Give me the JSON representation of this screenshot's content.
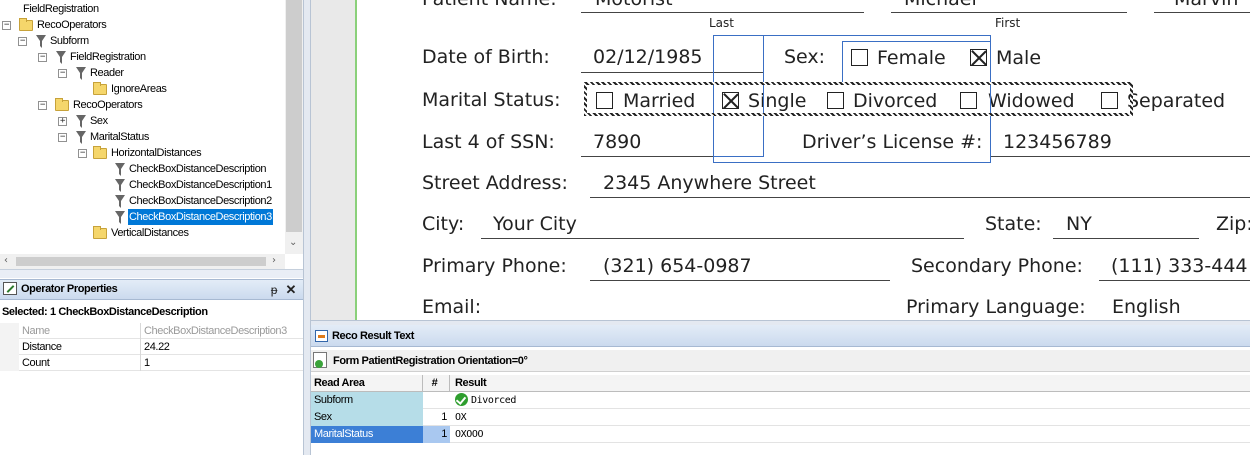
{
  "tree": {
    "nodes": [
      {
        "label": "FieldRegistration",
        "icon": "funnel-icon"
      },
      {
        "label": "RecoOperators",
        "icon": "folder-icon"
      },
      {
        "label": "Subform",
        "icon": "funnel-icon"
      },
      {
        "label": "FieldRegistration",
        "icon": "funnel-icon"
      },
      {
        "label": "Reader",
        "icon": "funnel-icon"
      },
      {
        "label": "IgnoreAreas",
        "icon": "folder-icon"
      },
      {
        "label": "RecoOperators",
        "icon": "folder-icon"
      },
      {
        "label": "Sex",
        "icon": "funnel-icon"
      },
      {
        "label": "MaritalStatus",
        "icon": "funnel-icon"
      },
      {
        "label": "HorizontalDistances",
        "icon": "folder-icon"
      },
      {
        "label": "CheckBoxDistanceDescription",
        "icon": "funnel-icon"
      },
      {
        "label": "CheckBoxDistanceDescription1",
        "icon": "funnel-icon"
      },
      {
        "label": "CheckBoxDistanceDescription2",
        "icon": "funnel-icon"
      },
      {
        "label": "CheckBoxDistanceDescription3",
        "icon": "funnel-icon",
        "selected": true
      },
      {
        "label": "VerticalDistances",
        "icon": "folder-icon"
      }
    ]
  },
  "properties": {
    "title": "Operator Properties",
    "pin_glyph": "ᵽ",
    "close_glyph": "✕",
    "selected_label": "Selected:  1 CheckBoxDistanceDescription",
    "rows": [
      {
        "name": "Name",
        "value": "CheckBoxDistanceDescription3",
        "readonly": true
      },
      {
        "name": "Distance",
        "value": "24.22"
      },
      {
        "name": "Count",
        "value": "1"
      }
    ]
  },
  "document": {
    "patient_name_label": "Patient Name:",
    "last_value": "Motorist",
    "first_value": "Michael",
    "middle_value": "Marvin",
    "last_caption": "Last",
    "first_caption": "First",
    "dob_label": "Date of Birth:",
    "dob_value": "02/12/1985",
    "sex_label": "Sex:",
    "sex_options": [
      {
        "label": "Female",
        "checked": false
      },
      {
        "label": "Male",
        "checked": true
      }
    ],
    "marital_label": "Marital Status:",
    "marital_options": [
      {
        "label": "Married",
        "checked": false
      },
      {
        "label": "Single",
        "checked": true
      },
      {
        "label": "Divorced",
        "checked": false
      },
      {
        "label": "Widowed",
        "checked": false
      },
      {
        "label": "Separated",
        "checked": false
      }
    ],
    "ssn_label": "Last 4 of SSN:",
    "ssn_value": "7890",
    "license_label": "Driver’s License #:",
    "license_value": "123456789",
    "street_label": "Street Address:",
    "street_value": "2345 Anywhere Street",
    "city_label": "City:",
    "city_value": "Your City",
    "state_label": "State:",
    "state_value": "NY",
    "zip_label": "Zip:",
    "primary_phone_label": "Primary Phone:",
    "primary_phone_value": "(321) 654-0987",
    "secondary_phone_label": "Secondary Phone:",
    "secondary_phone_value": "(111) 333-444",
    "email_label": "Email:",
    "language_label": "Primary Language:",
    "language_value": "English"
  },
  "reco": {
    "title": "Reco Result Text",
    "form_label": "Form PatientRegistration  Orientation=0°",
    "columns": [
      "Read Area",
      "#",
      "Result"
    ],
    "rows": [
      {
        "area": "Subform",
        "count": "",
        "result": "Divorced",
        "ok": true
      },
      {
        "area": "Sex",
        "count": "1",
        "result": "OX"
      },
      {
        "area": "MaritalStatus",
        "count": "1",
        "result": "OXOOO",
        "selected": true
      }
    ]
  }
}
